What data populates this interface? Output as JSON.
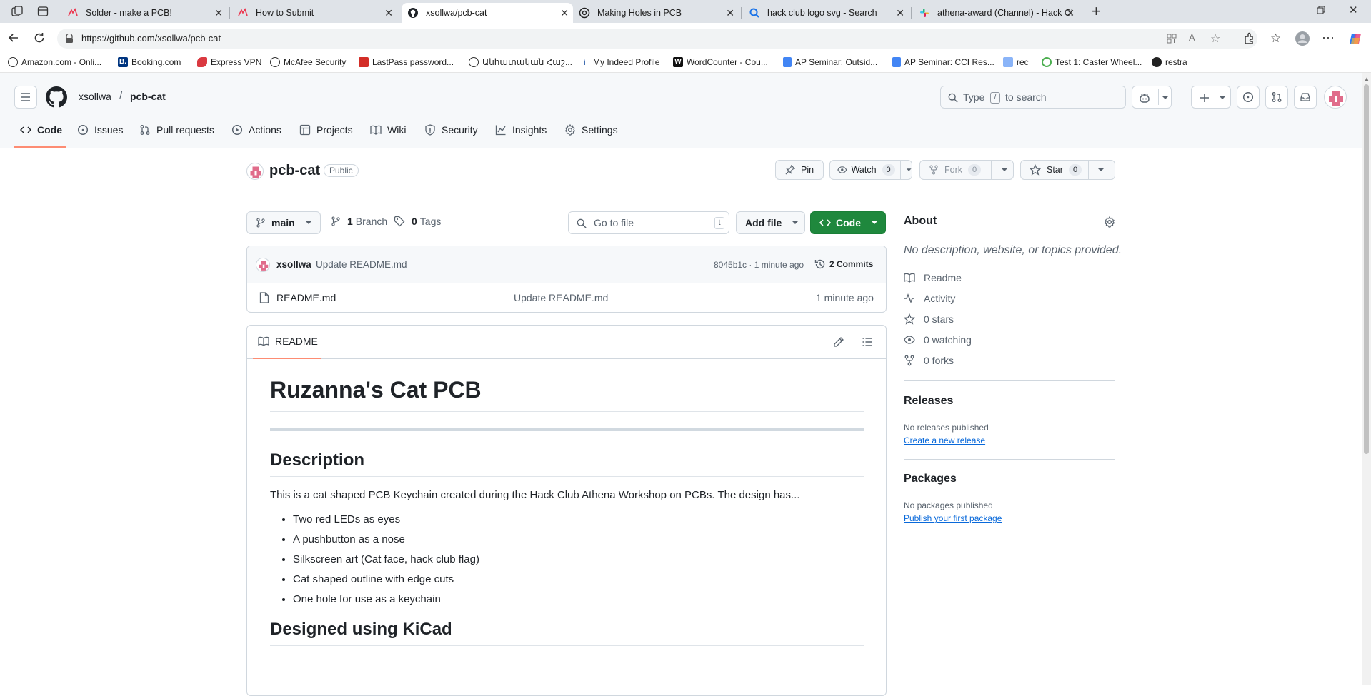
{
  "browser": {
    "tabs": [
      {
        "title": "Solder - make a PCB!"
      },
      {
        "title": "How to Submit"
      },
      {
        "title": "xsollwa/pcb-cat"
      },
      {
        "title": "Making Holes in PCB"
      },
      {
        "title": "hack club logo svg - Search"
      },
      {
        "title": "athena-award (Channel) - Hack Cl"
      }
    ],
    "url": "https://github.com/xsollwa/pcb-cat",
    "bookmarks": [
      {
        "label": "Amazon.com - Onli..."
      },
      {
        "label": "Booking.com"
      },
      {
        "label": "Express VPN"
      },
      {
        "label": "McAfee Security"
      },
      {
        "label": "LastPass password..."
      },
      {
        "label": "Անհատական Հաշ..."
      },
      {
        "label": "My Indeed Profile"
      },
      {
        "label": "WordCounter - Cou..."
      },
      {
        "label": "AP Seminar: Outsid..."
      },
      {
        "label": "AP Seminar: CCI Res..."
      },
      {
        "label": "rec"
      },
      {
        "label": "Test 1: Caster Wheel..."
      },
      {
        "label": "restra"
      }
    ]
  },
  "github": {
    "owner": "xsollwa",
    "separator": "/",
    "repo": "pcb-cat",
    "search_placeholder_pre": "Type",
    "search_key": "/",
    "search_placeholder_post": "to search",
    "nav": [
      "Code",
      "Issues",
      "Pull requests",
      "Actions",
      "Projects",
      "Wiki",
      "Security",
      "Insights",
      "Settings"
    ]
  },
  "repo": {
    "name": "pcb-cat",
    "visibility": "Public",
    "pin_label": "Pin",
    "watch_label": "Watch",
    "watch_count": "0",
    "fork_label": "Fork",
    "fork_count": "0",
    "star_label": "Star",
    "star_count": "0",
    "branch": "main",
    "branches_count": "1",
    "branches_label": "Branch",
    "tags_count": "0",
    "tags_label": "Tags",
    "goto_placeholder": "Go to file",
    "goto_key": "t",
    "add_file_label": "Add file",
    "code_label": "Code",
    "commit": {
      "author": "xsollwa",
      "message": "Update README.md",
      "sha_time": "8045b1c · 1 minute ago",
      "commits_label": "2 Commits"
    },
    "files": [
      {
        "name": "README.md",
        "message": "Update README.md",
        "time": "1 minute ago"
      }
    ]
  },
  "readme": {
    "tab_label": "README",
    "h1": "Ruzanna's Cat PCB",
    "h2_description": "Description",
    "paragraph": "This is a cat shaped PCB Keychain created during the Hack Club Athena Workshop on PCBs. The design has...",
    "bullets": [
      "Two red LEDs as eyes",
      "A pushbutton as a nose",
      "Silkscreen art (Cat face, hack club flag)",
      "Cat shaped outline with edge cuts",
      "One hole for use as a keychain"
    ],
    "h2_kicad": "Designed using KiCad"
  },
  "about": {
    "title": "About",
    "description": "No description, website, or topics provided.",
    "readme": "Readme",
    "activity": "Activity",
    "stars": "0 stars",
    "watching": "0 watching",
    "forks": "0 forks",
    "releases_title": "Releases",
    "releases_none": "No releases published",
    "releases_link": "Create a new release",
    "packages_title": "Packages",
    "packages_none": "No packages published",
    "packages_link": "Publish your first package"
  },
  "colors": {
    "accent_green": "#1f883d",
    "link_blue": "#0969da",
    "nav_underline": "#fd8c73"
  }
}
